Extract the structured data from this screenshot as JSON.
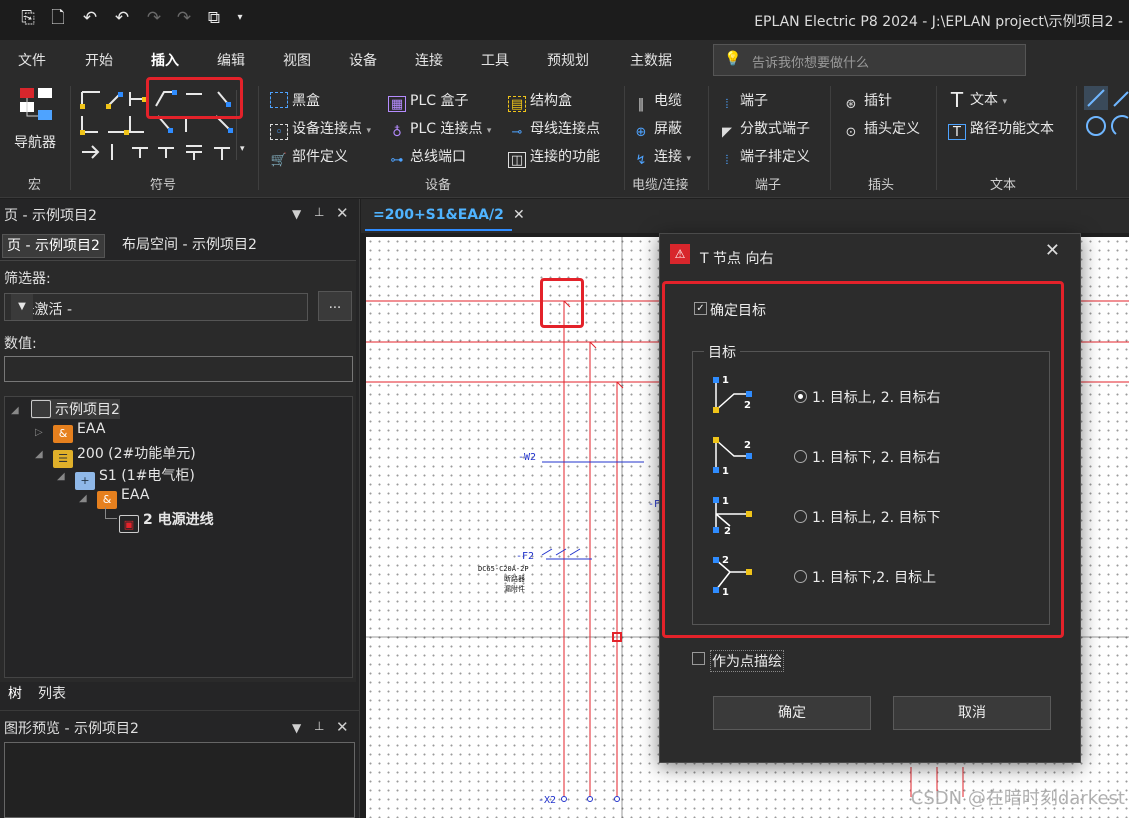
{
  "titlebar": {
    "app_title": "EPLAN Electric P8 2024 - J:\\EPLAN project\\示例项目2 -"
  },
  "menu": {
    "items": [
      "文件",
      "开始",
      "插入",
      "编辑",
      "视图",
      "设备",
      "连接",
      "工具",
      "预规划",
      "主数据"
    ],
    "active": "插入",
    "search_placeholder": "告诉我你想要做什么"
  },
  "ribbon": {
    "navigator_label": "导航器",
    "groups": [
      "宏",
      "符号",
      "设备",
      "电缆/连接",
      "端子",
      "插头",
      "文本"
    ],
    "device_items": [
      "黑盒",
      "设备连接点",
      "部件定义",
      "PLC 盒子",
      "PLC 连接点",
      "总线端口",
      "结构盒",
      "母线连接点",
      "连接的功能"
    ],
    "cable_items": [
      "电缆",
      "屏蔽",
      "连接"
    ],
    "terminal_items": [
      "端子",
      "分散式端子",
      "端子排定义"
    ],
    "plug_items": [
      "插针",
      "插头定义"
    ],
    "text_items": [
      "文本",
      "路径功能文本"
    ]
  },
  "left_panel": {
    "title": "页 - 示例项目2",
    "tabs": [
      "页 - 示例项目2",
      "布局空间 - 示例项目2"
    ],
    "filter_label": "筛选器:",
    "filter_value": "- 未激活 -",
    "filter_more": "...",
    "value_label": "数值:",
    "tree": [
      {
        "label": "示例项目2"
      },
      {
        "label": "EAA"
      },
      {
        "label": "200 (2#功能单元)"
      },
      {
        "label": "S1 (1#电气柜)"
      },
      {
        "label": "EAA"
      },
      {
        "label": "2 电源进线"
      }
    ],
    "bottom_tabs": [
      "树",
      "列表"
    ],
    "preview_title": "图形预览 - 示例项目2"
  },
  "document_tab": {
    "label": "=200+S1&EAA/2"
  },
  "drawing": {
    "labels": [
      "-W2",
      "-F2",
      "DC65-C20A-2P",
      "断路器",
      "漏附件",
      "-X2",
      "-F"
    ]
  },
  "dialog": {
    "title": "T 节点 向右",
    "confirm_target_label": "确定目标",
    "confirm_target_checked": true,
    "group_label": "目标",
    "options": [
      {
        "label": "1. 目标上, 2. 目标右",
        "selected": true
      },
      {
        "label": "1. 目标下, 2. 目标右",
        "selected": false
      },
      {
        "label": "1. 目标上, 2. 目标下",
        "selected": false
      },
      {
        "label": "1. 目标下,2. 目标上",
        "selected": false
      }
    ],
    "draw_as_point_label": "作为点描绘",
    "draw_as_point_checked": false,
    "ok_label": "确定",
    "cancel_label": "取消"
  },
  "watermark": "CSDN @在暗时刻darkest",
  "colors": {
    "accent": "#2f8cff",
    "highlight": "#e3222a",
    "wire": "#e3222a",
    "symbol_yellow": "#f0c419",
    "symbol_blue": "#2f8cff"
  }
}
